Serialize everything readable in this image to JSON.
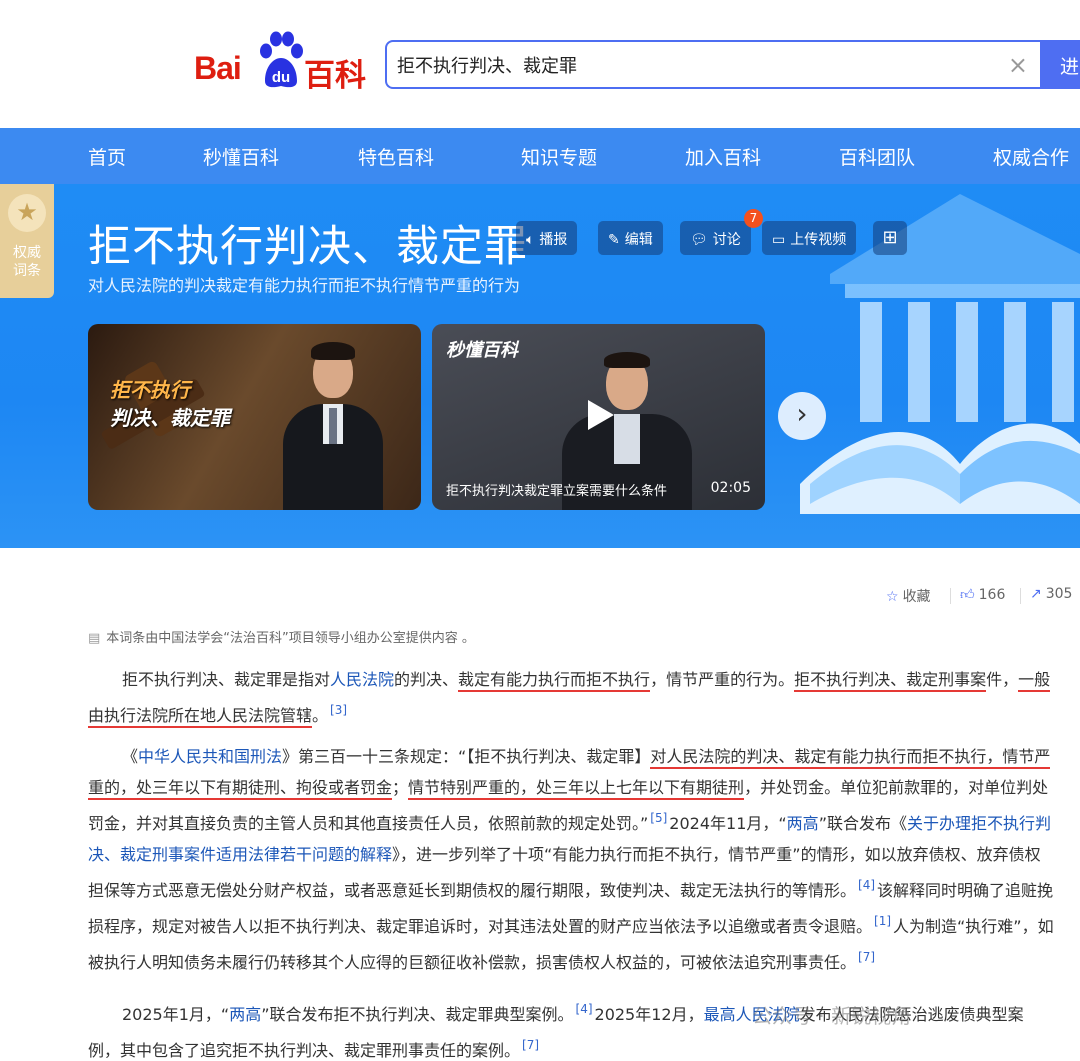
{
  "header": {
    "logo_left": "Bai",
    "logo_paw": "du",
    "logo_right": "百科",
    "search_value": "拒不执行判决、裁定罪",
    "clear_icon": "×",
    "search_button": "进"
  },
  "nav": {
    "items": [
      "首页",
      "秒懂百科",
      "特色百科",
      "知识专题",
      "加入百科",
      "百科团队",
      "权威合作"
    ]
  },
  "banner": {
    "badge": "权威词条",
    "title": "拒不执行判决、裁定罪",
    "subtitle": "对人民法院的判决裁定有能力执行而拒不执行情节严重的行为",
    "tools": {
      "broadcast": "播报",
      "edit": "编辑",
      "discuss": "讨论",
      "discuss_count": "7",
      "upload_video": "上传视频"
    },
    "card1": {
      "line1": "拒不执行",
      "line2": "判决、裁定罪"
    },
    "card2": {
      "brand": "秒懂百科",
      "title": "拒不执行判决裁定罪立案需要什么条件",
      "duration": "02:05"
    }
  },
  "actions": {
    "favorite": "收藏",
    "likes": "166",
    "shares": "305"
  },
  "content": {
    "source": "本词条由中国法学会“法治百科”项目领导小组办公室提供内容 。",
    "p1": {
      "t1": "拒不执行判决、裁定罪是指对",
      "link1": "人民法院",
      "t2": "的判决、",
      "u1": "裁定有能力执行而拒不执行",
      "t3": "，情节严重的行为。",
      "u2": "拒不执行判决、裁定刑事案",
      "t4": "件，",
      "u3": "一般由执行法院所在地人民法院管辖",
      "t5": "。",
      "ref": "[3]"
    },
    "p2": {
      "t1": "《",
      "link1": "中华人民共和国刑法",
      "t2": "》第三百一十三条规定：“【拒不执行判决、裁定罪】",
      "u1": "对人民法院的判决、裁定有能力执行而拒不执",
      "u2": "行，情节严重的，",
      "u3": "处三年以下有期徒刑、拘役或者罚金",
      "t3": "；",
      "u4": "情节特别严重的，处三年以上七年以下有期徒刑",
      "t4": "，并处罚金。单位犯前款罪的，对单位判处罚金，并对其直接负责的主管人员和其他直接责任人员，依照前款的规定处罚。”",
      "ref1": "[5]",
      "t5": "2024年11月，“",
      "link2": "两高",
      "t6": "”联合发布《",
      "link3": "关于办理拒不执行判决、裁定刑事案件适用法律若干问题的解释",
      "t7": "》，进一步列举了十项“有能力执行而拒不执行，情节严重”的情形，如以放弃债权、放弃债权担保等方式恶意无偿处分财产权益，或者恶意延长到期债权的履行期限，致使判决、裁定无法执行的等情形。",
      "ref2": "[4]",
      "t8": "该解释同时明确了追赃挽损程序，规定对被告人以拒不执行判决、裁定罪追诉时，对其违法处置的财产应当依法予以追缴或者责令退赔。",
      "ref3": "[1]",
      "t9": "人为制造“执行难”，如被执行人明知债务未履行仍转移其个人应得的巨额征收补偿款，损害债权人权益的，可被依法追究刑事责任。",
      "ref4": "[7]"
    },
    "p3": {
      "t1": "2025年1月，“",
      "link1": "两高",
      "t2": "”联合发布拒不执行判决、裁定罪典型案例。",
      "ref1": "[4]",
      "t3": "2025年12月，",
      "link2": "最高人民法院",
      "t4": "发布人民法院惩治逃废债典型案例，其中包含了追究拒不执行判决、裁定罪刑事责任的案例。",
      "ref2": "[7]"
    }
  },
  "watermark": "公众号 · 新锐视角",
  "colors": {
    "brand_red": "#de1e10",
    "brand_blue": "#2932e1",
    "nav_blue": "#3c8af1",
    "banner_blue": "#1f8cf5",
    "underline_red": "#e53935",
    "link_blue": "#1c57b8"
  }
}
